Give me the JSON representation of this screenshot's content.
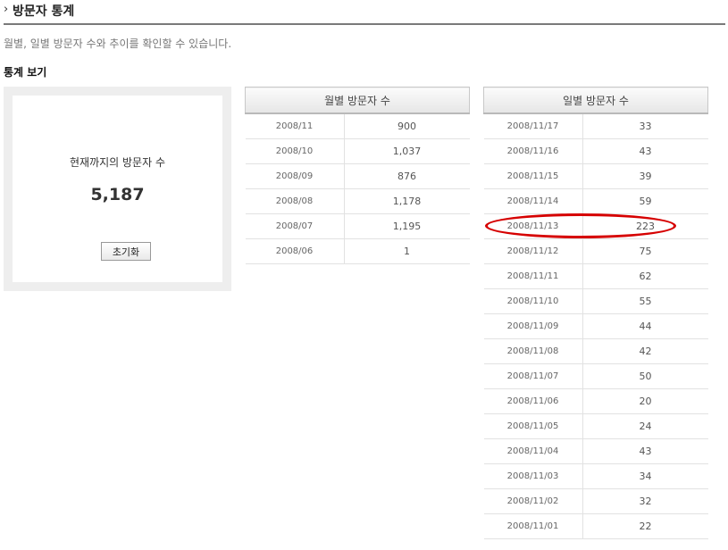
{
  "header": {
    "title": "방문자 통계"
  },
  "description": "월별, 일별 방문자 수와 추이를 확인할 수 있습니다.",
  "section_title": "통계 보기",
  "total": {
    "label": "현재까지의 방문자 수",
    "value": "5,187",
    "reset_label": "초기화"
  },
  "monthly": {
    "header": "월별 방문자 수",
    "rows": [
      {
        "date": "2008/11",
        "count": "900"
      },
      {
        "date": "2008/10",
        "count": "1,037"
      },
      {
        "date": "2008/09",
        "count": "876"
      },
      {
        "date": "2008/08",
        "count": "1,178"
      },
      {
        "date": "2008/07",
        "count": "1,195"
      },
      {
        "date": "2008/06",
        "count": "1"
      }
    ]
  },
  "daily": {
    "header": "일별 방문자 수",
    "rows": [
      {
        "date": "2008/11/17",
        "count": "33"
      },
      {
        "date": "2008/11/16",
        "count": "43"
      },
      {
        "date": "2008/11/15",
        "count": "39"
      },
      {
        "date": "2008/11/14",
        "count": "59"
      },
      {
        "date": "2008/11/13",
        "count": "223"
      },
      {
        "date": "2008/11/12",
        "count": "75"
      },
      {
        "date": "2008/11/11",
        "count": "62"
      },
      {
        "date": "2008/11/10",
        "count": "55"
      },
      {
        "date": "2008/11/09",
        "count": "44"
      },
      {
        "date": "2008/11/08",
        "count": "42"
      },
      {
        "date": "2008/11/07",
        "count": "50"
      },
      {
        "date": "2008/11/06",
        "count": "20"
      },
      {
        "date": "2008/11/05",
        "count": "24"
      },
      {
        "date": "2008/11/04",
        "count": "43"
      },
      {
        "date": "2008/11/03",
        "count": "34"
      },
      {
        "date": "2008/11/02",
        "count": "32"
      },
      {
        "date": "2008/11/01",
        "count": "22"
      }
    ]
  },
  "annotation": {
    "highlighted_date": "2008/11/13",
    "color": "#d60000"
  }
}
